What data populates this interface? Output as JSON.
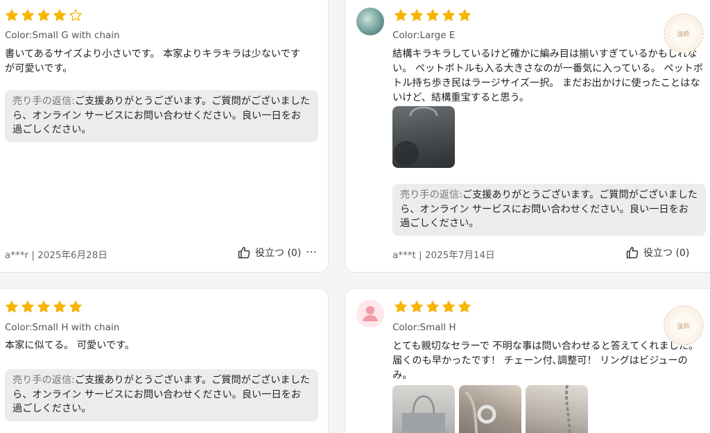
{
  "reply_label": "売り手の返信:",
  "reply_body": "ご支援ありがとうございます。ご質問がございましたら、オンライン サービスにお問い合わせください。良い一日をお過ごしください。",
  "helpful_label": "役立つ (0)",
  "more_icon": "⋯",
  "badge_text": "抜粋",
  "star_color": "#f7b500",
  "reviews": [
    {
      "rating": 4,
      "color": "Color:Small G with chain",
      "text": "書いてあるサイズより小さいです。 本家よりキラキラは少ないですが可愛いです。",
      "meta": "a***r | 2025年6月28日"
    },
    {
      "rating": 5,
      "color": "Color:Large E",
      "text": "結構キラキラしているけど確かに編み目は揃いすぎているかもしれない。 ペットボトルも入る大きさなのが一番気に入っている。 ペットボトル持ち歩き民はラージサイズ一択。 まだお出かけに使ったことはないけど、結構重宝すると思う。",
      "meta": "a***t | 2025年7月14日"
    },
    {
      "rating": 5,
      "color": "Color:Small H with chain",
      "text": "本家に似てる。 可愛いです。"
    },
    {
      "rating": 5,
      "color": "Color:Small H",
      "text": "とても親切なセラーで 不明な事は問い合わせると答えてくれました。 届くのも早かったです！ チェーン付､調整可！ リングはビジューのみ。"
    }
  ]
}
